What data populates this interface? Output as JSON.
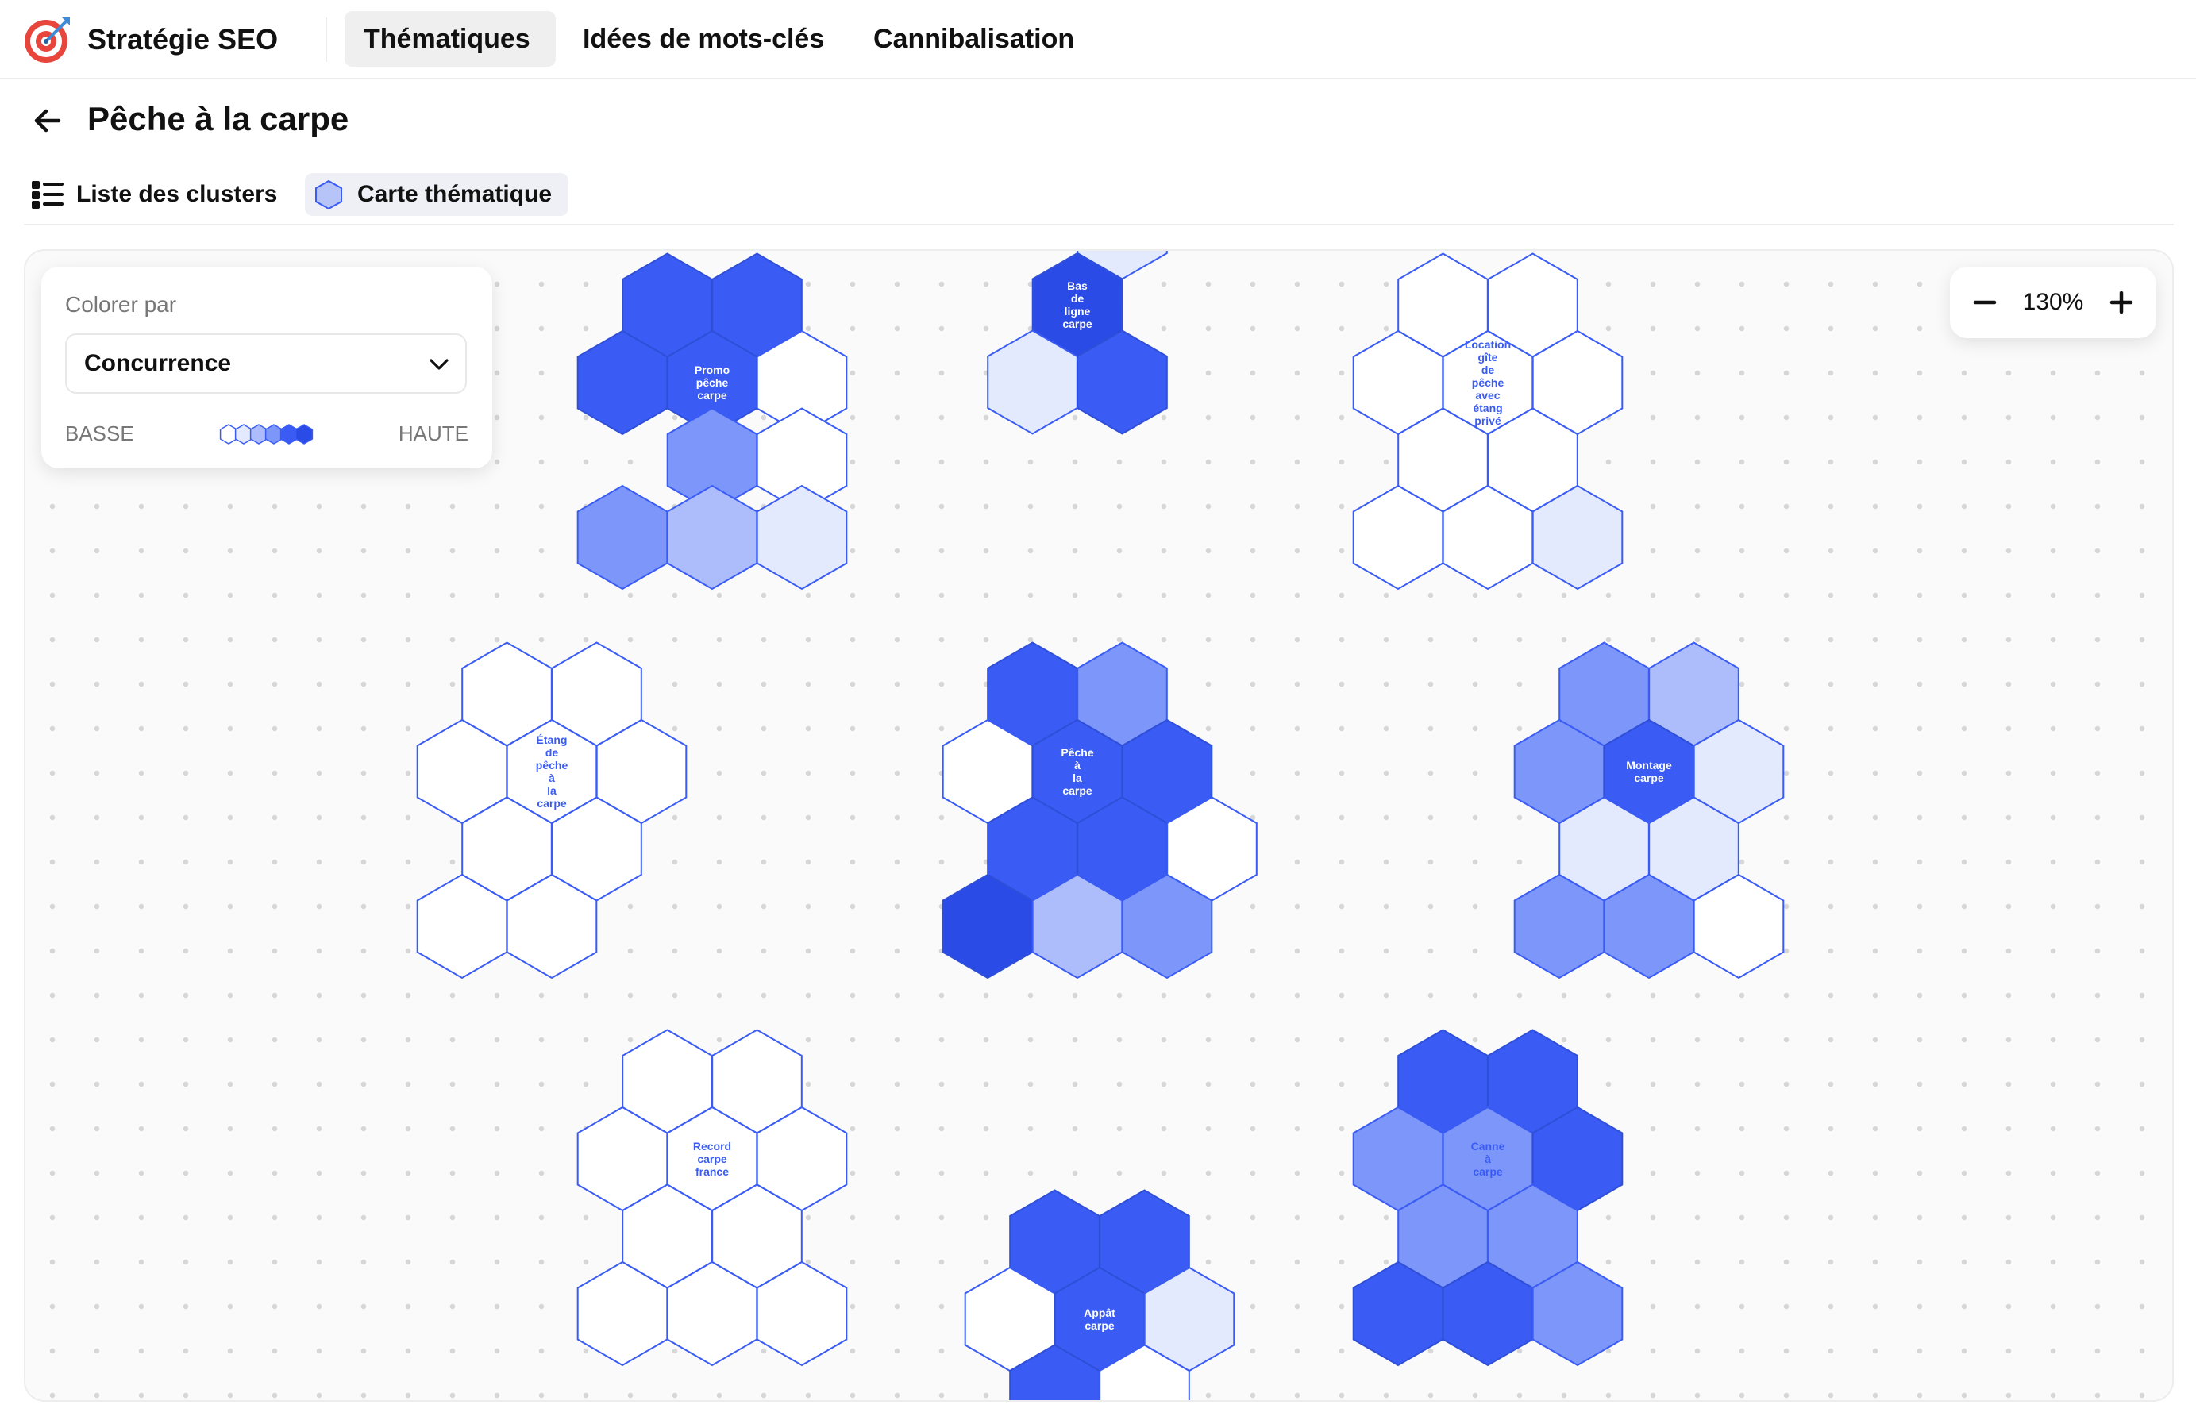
{
  "app": {
    "title": "Stratégie SEO",
    "logo_icon": "target-icon"
  },
  "nav": {
    "tabs": [
      {
        "label": "Thématiques",
        "active": true
      },
      {
        "label": "Idées de mots-clés",
        "active": false
      },
      {
        "label": "Cannibalisation",
        "active": false
      }
    ]
  },
  "page": {
    "title": "Pêche à la carpe",
    "back_icon": "arrow-left-icon"
  },
  "views": {
    "list": {
      "label": "Liste des clusters",
      "icon": "list-icon",
      "active": false
    },
    "map": {
      "label": "Carte thématique",
      "icon": "hexagon-icon",
      "active": true
    }
  },
  "color_panel": {
    "title": "Colorer par",
    "selected": "Concurrence",
    "low_label": "BASSE",
    "high_label": "HAUTE",
    "legend_levels": 6
  },
  "zoom": {
    "value": "130%"
  },
  "colors": {
    "accent": "#3c5ff0",
    "levels": [
      "#ffffff",
      "#e4eafd",
      "#adbdfb",
      "#7c96fa",
      "#3a5cf4",
      "#2b4be6"
    ],
    "stroke": "#3a5cf4"
  },
  "clusters": [
    {
      "name": "Promo pêche carpe",
      "labels": [
        "Promo",
        "pêche",
        "carpe"
      ],
      "levels": [
        4,
        4,
        4,
        4,
        0,
        3,
        0,
        3,
        2,
        1
      ]
    },
    {
      "name": "Bas de ligne carpe",
      "labels": [
        "Bas",
        "de",
        "ligne",
        "carpe"
      ],
      "levels": [
        1,
        5,
        1,
        4
      ]
    },
    {
      "name": "Location gîte de pêche avec étang privé",
      "labels": [
        "Location",
        "gîte",
        "de",
        "pêche",
        "avec",
        "étang",
        "privé"
      ],
      "levels": [
        0,
        0,
        0,
        0,
        0,
        0,
        0,
        0,
        0,
        1
      ]
    },
    {
      "name": "Étang de pêche à la carpe",
      "labels": [
        "Étang",
        "de",
        "pêche",
        "à",
        "la",
        "carpe"
      ],
      "levels": [
        0,
        0,
        0,
        0,
        0,
        0,
        0,
        0,
        0
      ]
    },
    {
      "name": "Pêche à la carpe",
      "labels": [
        "Pêche",
        "à",
        "la",
        "carpe"
      ],
      "levels": [
        4,
        3,
        0,
        4,
        4,
        4,
        4,
        0,
        5,
        2,
        3
      ]
    },
    {
      "name": "Montage carpe",
      "labels": [
        "Montage",
        "carpe"
      ],
      "levels": [
        3,
        2,
        3,
        4,
        1,
        1,
        1,
        3,
        3,
        0
      ]
    },
    {
      "name": "Record carpe france",
      "labels": [
        "Record",
        "carpe",
        "france"
      ],
      "levels": [
        0,
        0,
        0,
        0,
        0,
        0,
        0,
        0,
        0,
        0
      ]
    },
    {
      "name": "Appât carpe",
      "labels": [
        "Appât",
        "carpe"
      ],
      "levels": [
        4,
        4,
        0,
        4,
        1,
        4,
        0
      ]
    },
    {
      "name": "Canne à carpe",
      "labels": [
        "Canne",
        "à",
        "carpe"
      ],
      "levels": [
        4,
        4,
        3,
        3,
        4,
        3,
        3,
        4,
        4,
        3
      ]
    }
  ]
}
